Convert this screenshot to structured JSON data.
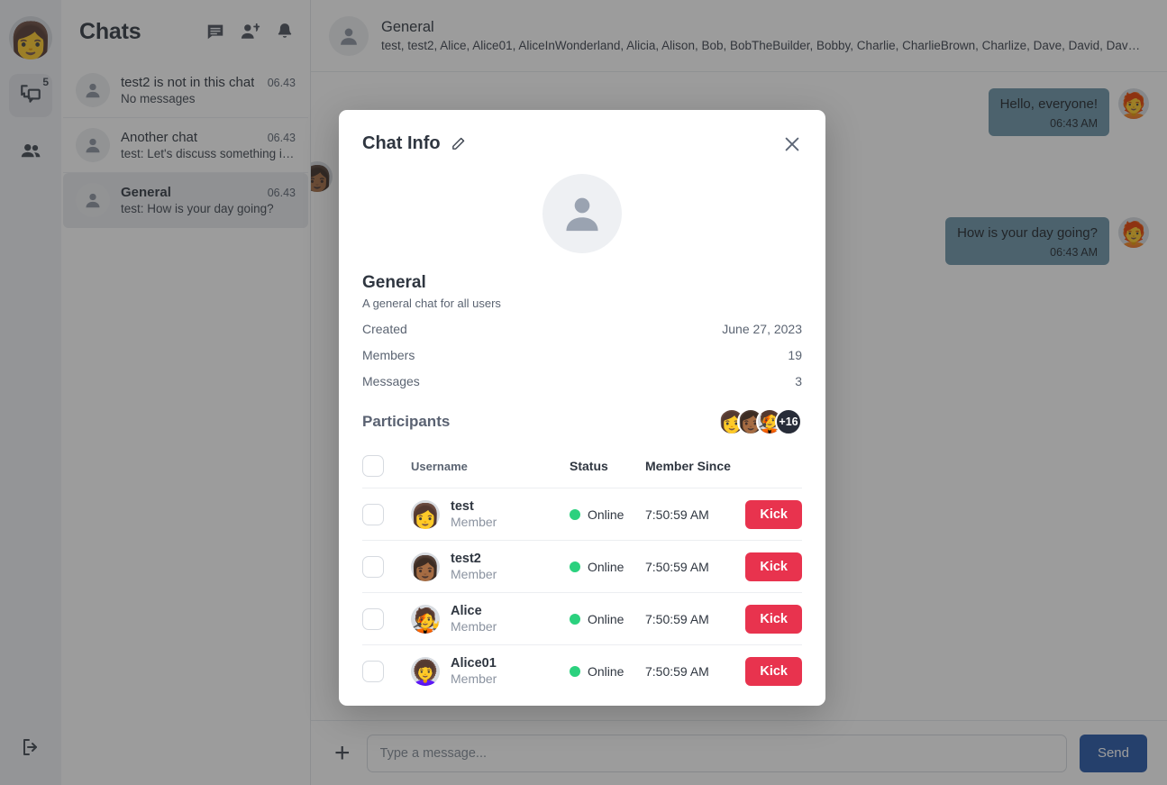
{
  "rail": {
    "avatar_icon": "user-avatar",
    "chats_icon": "chats-icon",
    "chats_badge": "5",
    "contacts_icon": "contacts-icon",
    "logout_icon": "logout-icon"
  },
  "sidebar": {
    "title": "Chats",
    "actions": [
      {
        "name": "new-message-icon",
        "label": "new-message-icon"
      },
      {
        "name": "add-contact-icon",
        "label": "add-contact-icon"
      },
      {
        "name": "notifications-bell-icon",
        "label": "notifications-bell-icon"
      }
    ],
    "chats": [
      {
        "name": "test2 is not in this chat",
        "time": "06.43",
        "preview": "No messages"
      },
      {
        "name": "Another chat",
        "time": "06.43",
        "preview": "test: Let's discuss something in…"
      },
      {
        "name": "General",
        "time": "06.43",
        "preview": "test: How is your day going?"
      }
    ]
  },
  "main": {
    "header": {
      "title": "General",
      "members": "test, test2, Alice, Alice01, AliceInWonderland, Alicia, Alison, Bob, BobTheBuilder, Bobby, Charlie, CharlieBrown, Charlize, Dave, David, Dav…"
    },
    "messages": [
      {
        "text": "Hello, everyone!",
        "time": "06:43 AM",
        "side": "out",
        "avatar": "🧑‍🦰"
      },
      {
        "text": "How is your day going?",
        "time": "06:43 AM",
        "side": "out",
        "avatar": "🧑‍🦰"
      }
    ],
    "composer": {
      "add_label": "+",
      "placeholder": "Type a message...",
      "input_value": "",
      "send_label": "Send"
    }
  },
  "modal": {
    "title": "Chat Info",
    "edit_icon": "edit-pencil-icon",
    "close_icon": "close-icon",
    "group_avatar_icon": "group-avatar-placeholder",
    "group_name": "General",
    "group_description": "A general chat for all users",
    "info": [
      {
        "label": "Created",
        "value": "June 27, 2023"
      },
      {
        "label": "Members",
        "value": "19"
      },
      {
        "label": "Messages",
        "value": "3"
      }
    ],
    "participants_title": "Participants",
    "avatar_stack": [
      "👩",
      "👩🏾",
      "🧑‍🎤"
    ],
    "avatar_stack_more": "+16",
    "table": {
      "columns": [
        "Username",
        "Status",
        "Member Since"
      ],
      "rows": [
        {
          "username": "test",
          "role": "Member",
          "status": "Online",
          "since": "7:50:59 AM",
          "action": "Kick",
          "avatar": "👩"
        },
        {
          "username": "test2",
          "role": "Member",
          "status": "Online",
          "since": "7:50:59 AM",
          "action": "Kick",
          "avatar": "👩🏾"
        },
        {
          "username": "Alice",
          "role": "Member",
          "status": "Online",
          "since": "7:50:59 AM",
          "action": "Kick",
          "avatar": "🧑‍🎤"
        },
        {
          "username": "Alice01",
          "role": "Member",
          "status": "Online",
          "since": "7:50:59 AM",
          "action": "Kick",
          "avatar": "👩‍🦱"
        }
      ]
    }
  },
  "colors": {
    "accent_send": "#2456a6",
    "danger_kick": "#e8334e",
    "online_green": "#2bd17e",
    "bubble_out": "#6b94a8",
    "rail_bg": "#f0f2f5"
  }
}
